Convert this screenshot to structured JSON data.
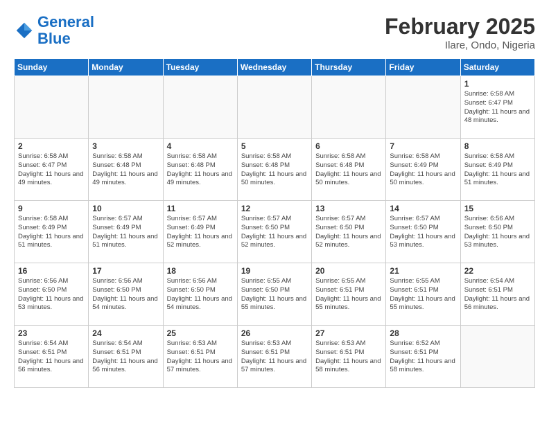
{
  "header": {
    "logo_line1": "General",
    "logo_line2": "Blue",
    "month": "February 2025",
    "location": "Ilare, Ondo, Nigeria"
  },
  "weekdays": [
    "Sunday",
    "Monday",
    "Tuesday",
    "Wednesday",
    "Thursday",
    "Friday",
    "Saturday"
  ],
  "weeks": [
    [
      {
        "day": "",
        "info": ""
      },
      {
        "day": "",
        "info": ""
      },
      {
        "day": "",
        "info": ""
      },
      {
        "day": "",
        "info": ""
      },
      {
        "day": "",
        "info": ""
      },
      {
        "day": "",
        "info": ""
      },
      {
        "day": "1",
        "info": "Sunrise: 6:58 AM\nSunset: 6:47 PM\nDaylight: 11 hours and 48 minutes."
      }
    ],
    [
      {
        "day": "2",
        "info": "Sunrise: 6:58 AM\nSunset: 6:47 PM\nDaylight: 11 hours and 49 minutes."
      },
      {
        "day": "3",
        "info": "Sunrise: 6:58 AM\nSunset: 6:48 PM\nDaylight: 11 hours and 49 minutes."
      },
      {
        "day": "4",
        "info": "Sunrise: 6:58 AM\nSunset: 6:48 PM\nDaylight: 11 hours and 49 minutes."
      },
      {
        "day": "5",
        "info": "Sunrise: 6:58 AM\nSunset: 6:48 PM\nDaylight: 11 hours and 50 minutes."
      },
      {
        "day": "6",
        "info": "Sunrise: 6:58 AM\nSunset: 6:48 PM\nDaylight: 11 hours and 50 minutes."
      },
      {
        "day": "7",
        "info": "Sunrise: 6:58 AM\nSunset: 6:49 PM\nDaylight: 11 hours and 50 minutes."
      },
      {
        "day": "8",
        "info": "Sunrise: 6:58 AM\nSunset: 6:49 PM\nDaylight: 11 hours and 51 minutes."
      }
    ],
    [
      {
        "day": "9",
        "info": "Sunrise: 6:58 AM\nSunset: 6:49 PM\nDaylight: 11 hours and 51 minutes."
      },
      {
        "day": "10",
        "info": "Sunrise: 6:57 AM\nSunset: 6:49 PM\nDaylight: 11 hours and 51 minutes."
      },
      {
        "day": "11",
        "info": "Sunrise: 6:57 AM\nSunset: 6:49 PM\nDaylight: 11 hours and 52 minutes."
      },
      {
        "day": "12",
        "info": "Sunrise: 6:57 AM\nSunset: 6:50 PM\nDaylight: 11 hours and 52 minutes."
      },
      {
        "day": "13",
        "info": "Sunrise: 6:57 AM\nSunset: 6:50 PM\nDaylight: 11 hours and 52 minutes."
      },
      {
        "day": "14",
        "info": "Sunrise: 6:57 AM\nSunset: 6:50 PM\nDaylight: 11 hours and 53 minutes."
      },
      {
        "day": "15",
        "info": "Sunrise: 6:56 AM\nSunset: 6:50 PM\nDaylight: 11 hours and 53 minutes."
      }
    ],
    [
      {
        "day": "16",
        "info": "Sunrise: 6:56 AM\nSunset: 6:50 PM\nDaylight: 11 hours and 53 minutes."
      },
      {
        "day": "17",
        "info": "Sunrise: 6:56 AM\nSunset: 6:50 PM\nDaylight: 11 hours and 54 minutes."
      },
      {
        "day": "18",
        "info": "Sunrise: 6:56 AM\nSunset: 6:50 PM\nDaylight: 11 hours and 54 minutes."
      },
      {
        "day": "19",
        "info": "Sunrise: 6:55 AM\nSunset: 6:50 PM\nDaylight: 11 hours and 55 minutes."
      },
      {
        "day": "20",
        "info": "Sunrise: 6:55 AM\nSunset: 6:51 PM\nDaylight: 11 hours and 55 minutes."
      },
      {
        "day": "21",
        "info": "Sunrise: 6:55 AM\nSunset: 6:51 PM\nDaylight: 11 hours and 55 minutes."
      },
      {
        "day": "22",
        "info": "Sunrise: 6:54 AM\nSunset: 6:51 PM\nDaylight: 11 hours and 56 minutes."
      }
    ],
    [
      {
        "day": "23",
        "info": "Sunrise: 6:54 AM\nSunset: 6:51 PM\nDaylight: 11 hours and 56 minutes."
      },
      {
        "day": "24",
        "info": "Sunrise: 6:54 AM\nSunset: 6:51 PM\nDaylight: 11 hours and 56 minutes."
      },
      {
        "day": "25",
        "info": "Sunrise: 6:53 AM\nSunset: 6:51 PM\nDaylight: 11 hours and 57 minutes."
      },
      {
        "day": "26",
        "info": "Sunrise: 6:53 AM\nSunset: 6:51 PM\nDaylight: 11 hours and 57 minutes."
      },
      {
        "day": "27",
        "info": "Sunrise: 6:53 AM\nSunset: 6:51 PM\nDaylight: 11 hours and 58 minutes."
      },
      {
        "day": "28",
        "info": "Sunrise: 6:52 AM\nSunset: 6:51 PM\nDaylight: 11 hours and 58 minutes."
      },
      {
        "day": "",
        "info": ""
      }
    ]
  ]
}
